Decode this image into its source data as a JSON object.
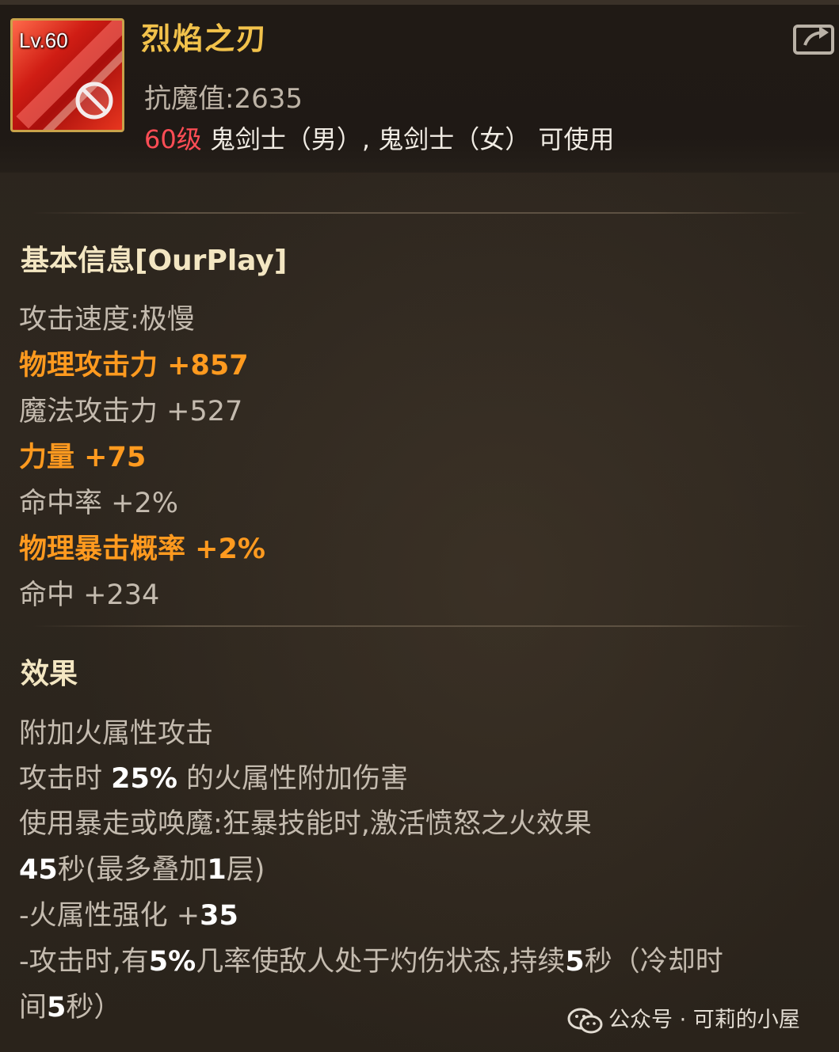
{
  "item": {
    "level_badge": "Lv.60",
    "name": "烈焰之刃",
    "resist_label": "抗魔值:2635",
    "level_req": "60级",
    "classes": " 鬼剑士（男）, 鬼剑士（女） 可使用"
  },
  "basic": {
    "title": "基本信息[OurPlay]",
    "lines": [
      {
        "text": "攻击速度:极慢",
        "color": "gray"
      },
      {
        "text": "物理攻击力 +857",
        "color": "orange"
      },
      {
        "text": "魔法攻击力 +527",
        "color": "gray"
      },
      {
        "text": "力量 +75",
        "color": "orange"
      },
      {
        "text": "命中率 +2%",
        "color": "gray"
      },
      {
        "text": "物理暴击概率 +2%",
        "color": "orange"
      },
      {
        "text": "命中 +234",
        "color": "gray"
      }
    ]
  },
  "effect": {
    "title": "效果",
    "l1": "附加火属性攻击",
    "l2_a": "攻击时 ",
    "l2_b": "25%",
    "l2_c": " 的火属性附加伤害",
    "l3": "使用暴走或唤魔:狂暴技能时,激活愤怒之火效果",
    "l4_a": "45",
    "l4_b": "秒(最多叠加",
    "l4_c": "1",
    "l4_d": "层)",
    "l5_a": "-火属性强化 +",
    "l5_b": "35",
    "l6_a": "-攻击时,有",
    "l6_b": "5%",
    "l6_c": "几率使敌人处于灼伤状态,持续",
    "l6_d": "5",
    "l6_e": "秒（冷却时",
    "l7_a": "间",
    "l7_b": "5",
    "l7_c": "秒）"
  },
  "watermark": "公众号 · 可莉的小屋",
  "icons": {
    "share": "share-icon",
    "ban": "ban-icon",
    "wechat": "wechat-icon"
  },
  "colors": {
    "title_gold": "#f2c24b",
    "stat_orange": "#ff9a1f",
    "stat_gray": "#c4bbaf",
    "level_red": "#ff4d55"
  }
}
